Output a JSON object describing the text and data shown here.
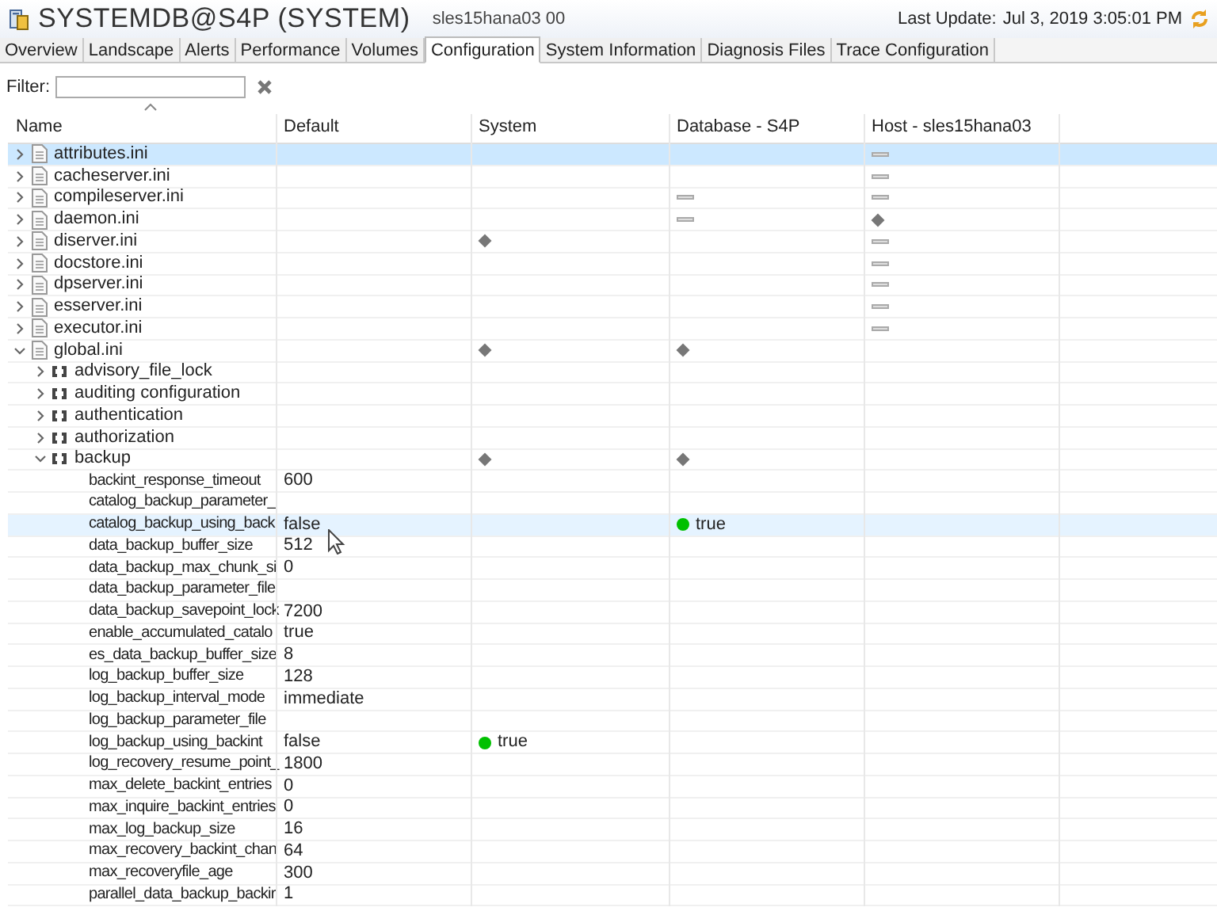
{
  "header": {
    "title": "SYSTEMDB@S4P (SYSTEM)",
    "subtitle": "sles15hana03 00",
    "last_update_label": "Last Update:",
    "last_update": "Jul 3, 2019 3:05:01 PM"
  },
  "tabs": [
    {
      "label": "Overview",
      "selected": false
    },
    {
      "label": "Landscape",
      "selected": false
    },
    {
      "label": "Alerts",
      "selected": false
    },
    {
      "label": "Performance",
      "selected": false
    },
    {
      "label": "Volumes",
      "selected": false
    },
    {
      "label": "Configuration",
      "selected": true
    },
    {
      "label": "System Information",
      "selected": false
    },
    {
      "label": "Diagnosis Files",
      "selected": false
    },
    {
      "label": "Trace Configuration",
      "selected": false
    }
  ],
  "filter": {
    "label": "Filter:"
  },
  "table": {
    "columns": [
      "Name",
      "Default",
      "System",
      "Database - S4P",
      "Host - sles15hana03"
    ],
    "rows": [
      {
        "kind": "file",
        "name": "attributes.ini",
        "expanded": false,
        "selected": true,
        "hovered": false,
        "host": {
          "kind": "dash"
        }
      },
      {
        "kind": "file",
        "name": "cacheserver.ini",
        "expanded": false,
        "selected": false,
        "hovered": false,
        "host": {
          "kind": "dash"
        }
      },
      {
        "kind": "file",
        "name": "compileserver.ini",
        "expanded": false,
        "selected": false,
        "hovered": false,
        "database": {
          "kind": "dash"
        },
        "host": {
          "kind": "dash"
        }
      },
      {
        "kind": "file",
        "name": "daemon.ini",
        "expanded": false,
        "selected": false,
        "hovered": false,
        "database": {
          "kind": "dash"
        },
        "host": {
          "kind": "diamond"
        }
      },
      {
        "kind": "file",
        "name": "diserver.ini",
        "expanded": false,
        "selected": false,
        "hovered": false,
        "system": {
          "kind": "diamond"
        },
        "host": {
          "kind": "dash"
        }
      },
      {
        "kind": "file",
        "name": "docstore.ini",
        "expanded": false,
        "selected": false,
        "hovered": false,
        "host": {
          "kind": "dash"
        }
      },
      {
        "kind": "file",
        "name": "dpserver.ini",
        "expanded": false,
        "selected": false,
        "hovered": false,
        "host": {
          "kind": "dash"
        }
      },
      {
        "kind": "file",
        "name": "esserver.ini",
        "expanded": false,
        "selected": false,
        "hovered": false,
        "host": {
          "kind": "dash"
        }
      },
      {
        "kind": "file",
        "name": "executor.ini",
        "expanded": false,
        "selected": false,
        "hovered": false,
        "host": {
          "kind": "dash"
        }
      },
      {
        "kind": "file",
        "name": "global.ini",
        "expanded": true,
        "selected": false,
        "hovered": false,
        "system": {
          "kind": "diamond"
        },
        "database": {
          "kind": "diamond"
        },
        "children": [
          {
            "kind": "section",
            "name": "advisory_file_lock",
            "expanded": false,
            "selected": false,
            "hovered": false
          },
          {
            "kind": "section",
            "name": "auditing configuration",
            "expanded": false,
            "selected": false,
            "hovered": false
          },
          {
            "kind": "section",
            "name": "authentication",
            "expanded": false,
            "selected": false,
            "hovered": false
          },
          {
            "kind": "section",
            "name": "authorization",
            "expanded": false,
            "selected": false,
            "hovered": false
          },
          {
            "kind": "section",
            "name": "backup",
            "expanded": true,
            "selected": false,
            "hovered": false,
            "system": {
              "kind": "diamond"
            },
            "database": {
              "kind": "diamond"
            },
            "children": [
              {
                "kind": "parameter",
                "name": "backint_response_timeout",
                "default": "600",
                "selected": false,
                "hovered": false
              },
              {
                "kind": "parameter",
                "name": "catalog_backup_parameter_",
                "selected": false,
                "hovered": false
              },
              {
                "kind": "parameter",
                "name": "catalog_backup_using_back",
                "default": "false",
                "selected": false,
                "hovered": true,
                "database": {
                  "value": "true",
                  "color": "#00c000"
                }
              },
              {
                "kind": "parameter",
                "name": "data_backup_buffer_size",
                "default": "512",
                "selected": false,
                "hovered": false
              },
              {
                "kind": "parameter",
                "name": "data_backup_max_chunk_si",
                "default": "0",
                "selected": false,
                "hovered": false
              },
              {
                "kind": "parameter",
                "name": "data_backup_parameter_file",
                "selected": false,
                "hovered": false
              },
              {
                "kind": "parameter",
                "name": "data_backup_savepoint_lock",
                "default": "7200",
                "selected": false,
                "hovered": false
              },
              {
                "kind": "parameter",
                "name": "enable_accumulated_catalo",
                "default": "true",
                "selected": false,
                "hovered": false
              },
              {
                "kind": "parameter",
                "name": "es_data_backup_buffer_size",
                "default": "8",
                "selected": false,
                "hovered": false
              },
              {
                "kind": "parameter",
                "name": "log_backup_buffer_size",
                "default": "128",
                "selected": false,
                "hovered": false
              },
              {
                "kind": "parameter",
                "name": "log_backup_interval_mode",
                "default": "immediate",
                "selected": false,
                "hovered": false
              },
              {
                "kind": "parameter",
                "name": "log_backup_parameter_file",
                "selected": false,
                "hovered": false
              },
              {
                "kind": "parameter",
                "name": "log_backup_using_backint",
                "default": "false",
                "selected": false,
                "hovered": false,
                "system": {
                  "value": "true",
                  "color": "#00c000"
                }
              },
              {
                "kind": "parameter",
                "name": "log_recovery_resume_point_",
                "default": "1800",
                "selected": false,
                "hovered": false
              },
              {
                "kind": "parameter",
                "name": "max_delete_backint_entries",
                "default": "0",
                "selected": false,
                "hovered": false
              },
              {
                "kind": "parameter",
                "name": "max_inquire_backint_entries",
                "default": "0",
                "selected": false,
                "hovered": false
              },
              {
                "kind": "parameter",
                "name": "max_log_backup_size",
                "default": "16",
                "selected": false,
                "hovered": false
              },
              {
                "kind": "parameter",
                "name": "max_recovery_backint_chan",
                "default": "64",
                "selected": false,
                "hovered": false
              },
              {
                "kind": "parameter",
                "name": "max_recoveryfile_age",
                "default": "300",
                "selected": false,
                "hovered": false
              },
              {
                "kind": "parameter",
                "name": "parallel_data_backup_backir",
                "default": "1",
                "selected": false,
                "hovered": false
              }
            ]
          }
        ]
      }
    ]
  }
}
